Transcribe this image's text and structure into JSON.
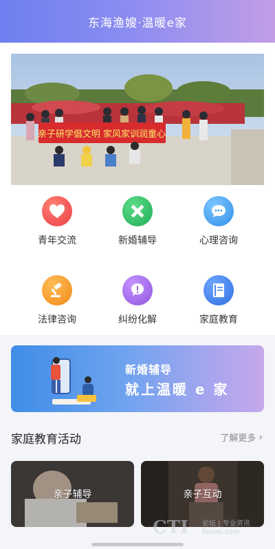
{
  "header": {
    "title": "东海渔嫂·温暖e家"
  },
  "banner": {
    "caption_main": "亲子研学倡文明 家风家训润童心"
  },
  "services": [
    {
      "label": "青年交流",
      "icon": "heart-icon",
      "color": "#f0534f"
    },
    {
      "label": "新婚辅导",
      "icon": "cross-icon",
      "color": "#34c06a"
    },
    {
      "label": "心理咨询",
      "icon": "chat-bubble-icon",
      "color": "#3ba0ef"
    },
    {
      "label": "法律咨询",
      "icon": "gavel-icon",
      "color": "#f7982a"
    },
    {
      "label": "纠纷化解",
      "icon": "dispute-bubble-icon",
      "color": "#a56be8"
    },
    {
      "label": "家庭教育",
      "icon": "book-icon",
      "color": "#3e7ff0"
    }
  ],
  "promo": {
    "line1": "新婚辅导",
    "line2": "就上温暖 e 家"
  },
  "activities": {
    "title": "家庭教育活动",
    "more_label": "了解更多",
    "cards": [
      {
        "label": "亲子辅导"
      },
      {
        "label": "亲子互动"
      }
    ]
  },
  "watermark": {
    "brand": "CTI",
    "line1": "论坛 | 专业资讯",
    "line2": "forum.com"
  }
}
